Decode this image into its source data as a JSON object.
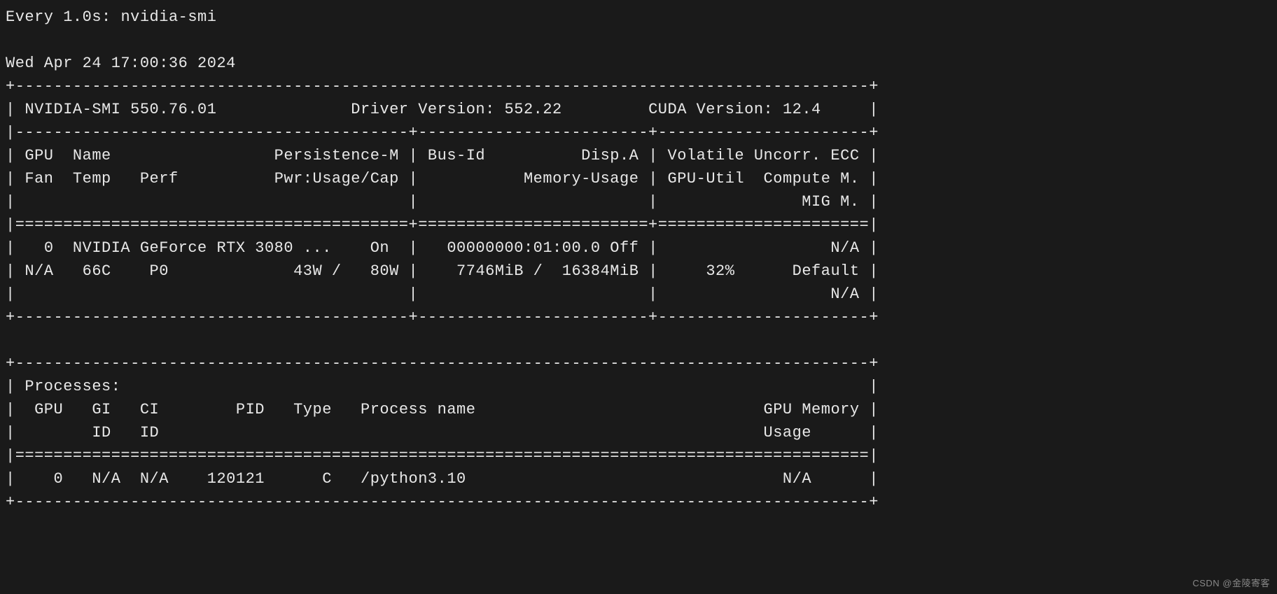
{
  "watch": {
    "prefix": "Every 1.0s: ",
    "command": "nvidia-smi"
  },
  "timestamp": "Wed Apr 24 17:00:36 2024",
  "header": {
    "smi_version": "NVIDIA-SMI 550.76.01",
    "driver_version_label": "Driver Version:",
    "driver_version": "552.22",
    "cuda_version_label": "CUDA Version:",
    "cuda_version": "12.4"
  },
  "columns": {
    "gpu_label": "GPU",
    "name_label": "Name",
    "persistence_label": "Persistence-M",
    "fan_label": "Fan",
    "temp_label": "Temp",
    "perf_label": "Perf",
    "pwr_label": "Pwr:Usage/Cap",
    "busid_label": "Bus-Id",
    "dispa_label": "Disp.A",
    "memusage_label": "Memory-Usage",
    "volatile_label": "Volatile Uncorr. ECC",
    "gpuutil_label": "GPU-Util",
    "compute_label": "Compute M.",
    "mig_label": "MIG M."
  },
  "gpus": [
    {
      "index": "0",
      "name": "NVIDIA GeForce RTX 3080 ...",
      "persistence": "On",
      "fan": "N/A",
      "temp": "66C",
      "perf": "P0",
      "pwr_usage": "43W",
      "pwr_cap": "80W",
      "bus_id": "00000000:01:00.0",
      "disp_a": "Off",
      "mem_used": "7746MiB",
      "mem_total": "16384MiB",
      "ecc": "N/A",
      "gpu_util": "32%",
      "compute_mode": "Default",
      "mig_mode": "N/A"
    }
  ],
  "processes": {
    "title": "Processes:",
    "cols": {
      "gpu": "GPU",
      "gi": "GI",
      "gi2": "ID",
      "ci": "CI",
      "ci2": "ID",
      "pid": "PID",
      "type": "Type",
      "name": "Process name",
      "mem": "GPU Memory",
      "mem2": "Usage"
    },
    "rows": [
      {
        "gpu": "0",
        "gi_id": "N/A",
        "ci_id": "N/A",
        "pid": "120121",
        "type": "C",
        "name": "/python3.10",
        "mem": "N/A"
      }
    ]
  },
  "watermark": "CSDN @金陵寄客"
}
